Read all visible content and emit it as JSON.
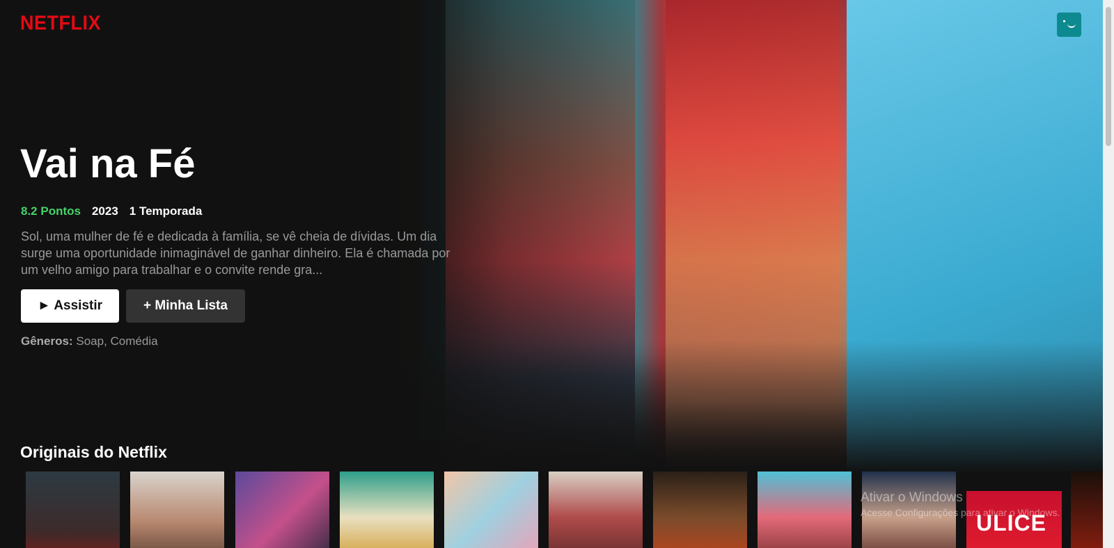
{
  "header": {
    "logo": "NETFLIX",
    "avatar_icon": "profile-smiley-icon"
  },
  "featured": {
    "title": "Vai na Fé",
    "score": "8.2 Pontos",
    "year": "2023",
    "seasons": "1 Temporada",
    "description": "Sol, uma mulher de fé e dedicada à família, se vê cheia de dívidas. Um dia surge uma oportunidade inimaginável de ganhar dinheiro. Ela é chamada por um velho amigo para trabalhar e o convite rende gra...",
    "watch_label": "► Assistir",
    "list_label": "+ Minha Lista",
    "genres_label": "Gêneros:",
    "genres_value": "Soap, Comédia"
  },
  "row": {
    "title": "Originais do Netflix",
    "tile_text": "ULICE"
  },
  "watermark": {
    "line1": "Ativar o Windows",
    "line2": "Acesse Configurações para ativar o Windows."
  },
  "colors": {
    "brand": "#e50914",
    "score": "#46d369",
    "background": "#111111"
  }
}
